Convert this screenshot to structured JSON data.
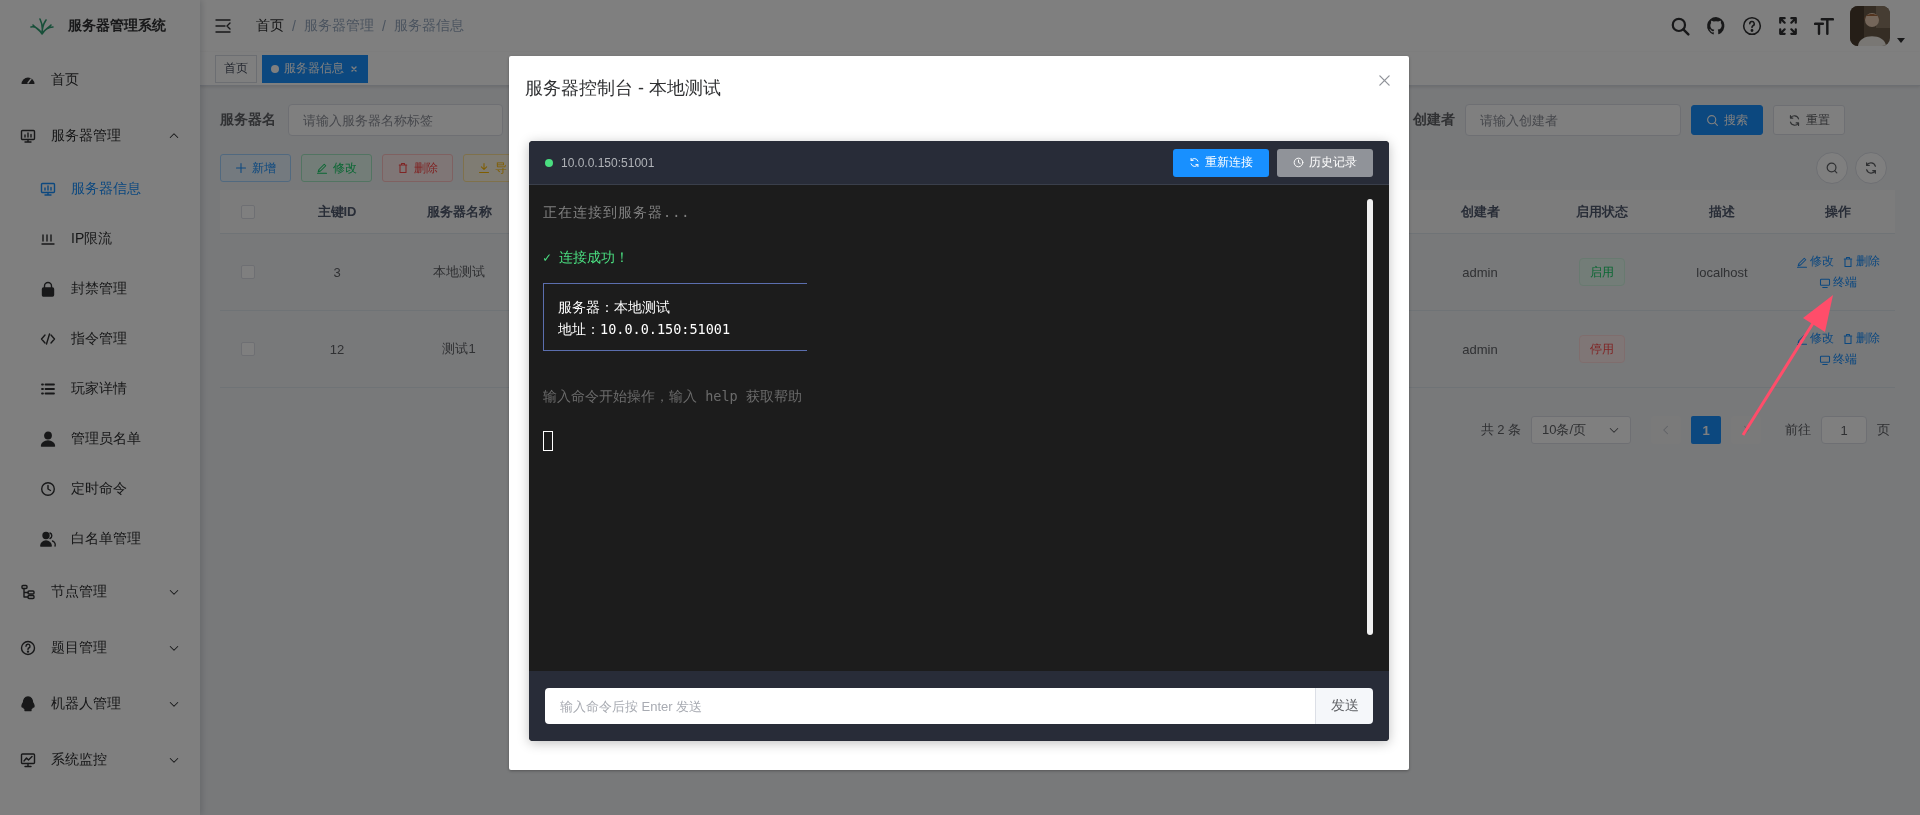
{
  "sidebar": {
    "logo_text": "服务器管理系统",
    "items": [
      {
        "kind": "link",
        "label": "首页"
      },
      {
        "kind": "group",
        "label": "服务器管理",
        "expanded": true,
        "children": [
          {
            "label": "服务器信息",
            "selected": true
          },
          {
            "label": "IP限流",
            "selected": false
          },
          {
            "label": "封禁管理",
            "selected": false
          },
          {
            "label": "指令管理",
            "selected": false
          },
          {
            "label": "玩家详情",
            "selected": false
          },
          {
            "label": "管理员名单",
            "selected": false
          },
          {
            "label": "定时命令",
            "selected": false
          },
          {
            "label": "白名单管理",
            "selected": false
          }
        ]
      },
      {
        "kind": "group",
        "label": "节点管理",
        "expanded": false
      },
      {
        "kind": "group",
        "label": "题目管理",
        "expanded": false
      },
      {
        "kind": "group",
        "label": "机器人管理",
        "expanded": false
      },
      {
        "kind": "group",
        "label": "系统监控",
        "expanded": false
      }
    ]
  },
  "header": {
    "breadcrumb": [
      "首页",
      "服务器管理",
      "服务器信息"
    ],
    "separator": "/"
  },
  "tabs": [
    {
      "label": "首页",
      "selected": false
    },
    {
      "label": "服务器信息",
      "selected": true
    }
  ],
  "search_form": {
    "fields": [
      {
        "label": "服务器名",
        "placeholder": "请输入服务器名称标签"
      },
      {
        "label": "创建者",
        "placeholder": "请输入创建者"
      }
    ],
    "search_button": "搜索",
    "reset_button": "重置"
  },
  "toolbar": [
    {
      "kind": "add",
      "label": "新增"
    },
    {
      "kind": "edit",
      "label": "修改"
    },
    {
      "kind": "delete",
      "label": "删除"
    },
    {
      "kind": "export",
      "label": "导"
    }
  ],
  "table": {
    "columns": [
      "主键ID",
      "服务器名称",
      "创建者",
      "启用状态",
      "描述",
      "操作"
    ],
    "select_all_checked": false,
    "rows": [
      {
        "checked": false,
        "id": "3",
        "name": "本地测试",
        "creator": "admin",
        "status": {
          "label": "启用",
          "enabled": true
        },
        "description": "localhost",
        "actions": [
          "修改",
          "删除",
          "终端"
        ]
      },
      {
        "checked": false,
        "id": "12",
        "name": "测试1",
        "creator": "admin",
        "status": {
          "label": "停用",
          "enabled": false
        },
        "actions": [
          "修改",
          "删除",
          "终端"
        ]
      }
    ]
  },
  "pagination": {
    "total": "共 2 条",
    "page_size": "10条/页",
    "prev_disabled": true,
    "pages": [
      {
        "label": "1",
        "selected": true
      }
    ],
    "next_disabled": true,
    "jump_label": "前往",
    "jump_value": "1",
    "jump_suffix": "页"
  },
  "dialog": {
    "title": "服务器控制台 - 本地测试",
    "terminal": {
      "address": "10.0.0.150:51001",
      "connected": true,
      "buttons": [
        {
          "kind": "primary",
          "label": "重新连接"
        },
        {
          "kind": "secondary",
          "label": "历史记录"
        }
      ],
      "lines": [
        {
          "kind": "info",
          "text": "正在连接到服务器..."
        },
        {
          "kind": "success",
          "text": "✓ 连接成功！"
        },
        {
          "kind": "box",
          "lines": [
            "服务器：本地测试",
            "地址：10.0.0.150:51001"
          ]
        },
        {
          "kind": "hint",
          "text": "输入命令开始操作，输入 help 获取帮助"
        },
        {
          "kind": "cursor"
        }
      ],
      "input_placeholder": "输入命令后按 Enter 发送",
      "send_button": "发送"
    }
  }
}
